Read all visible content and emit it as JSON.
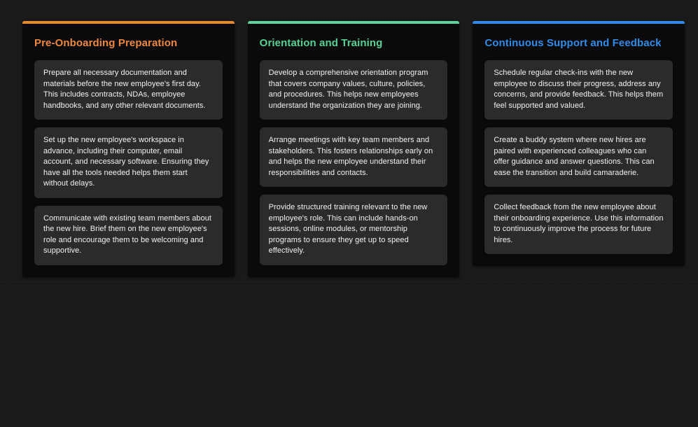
{
  "theme": {
    "page_background": "#1a1a1a",
    "panel_background": "#0a0a0a",
    "card_background": "#2b2b2b",
    "card_text_color": "#f2f2f2"
  },
  "columns": [
    {
      "title": "Pre-Onboarding Preparation",
      "accent_color": "#e8882e",
      "title_color": "#f0883e",
      "cards": [
        {
          "text": "Prepare all necessary documentation and materials before the new employee's first day. This includes contracts, NDAs, employee handbooks, and any other relevant documents."
        },
        {
          "text": "Set up the new employee's workspace in advance, including their computer, email account, and necessary software. Ensuring they have all the tools needed helps them start without delays."
        },
        {
          "text": "Communicate with existing team members about the new hire. Brief them on the new employee's role and encourage them to be welcoming and supportive."
        }
      ]
    },
    {
      "title": "Orientation and Training",
      "accent_color": "#5fd19a",
      "title_color": "#56d394",
      "cards": [
        {
          "text": "Develop a comprehensive orientation program that covers company values, culture, policies, and procedures. This helps new employees understand the organization they are joining."
        },
        {
          "text": "Arrange meetings with key team members and stakeholders. This fosters relationships early on and helps the new employee understand their responsibilities and contacts."
        },
        {
          "text": "Provide structured training relevant to the new employee's role. This can include hands-on sessions, online modules, or mentorship programs to ensure they get up to speed effectively."
        }
      ]
    },
    {
      "title": "Continuous Support and Feedback",
      "accent_color": "#2b8ae8",
      "title_color": "#2f8ce8",
      "cards": [
        {
          "text": "Schedule regular check-ins with the new employee to discuss their progress, address any concerns, and provide feedback. This helps them feel supported and valued."
        },
        {
          "text": "Create a buddy system where new hires are paired with experienced colleagues who can offer guidance and answer questions. This can ease the transition and build camaraderie."
        },
        {
          "text": "Collect feedback from the new employee about their onboarding experience. Use this information to continuously improve the process for future hires."
        }
      ]
    }
  ]
}
